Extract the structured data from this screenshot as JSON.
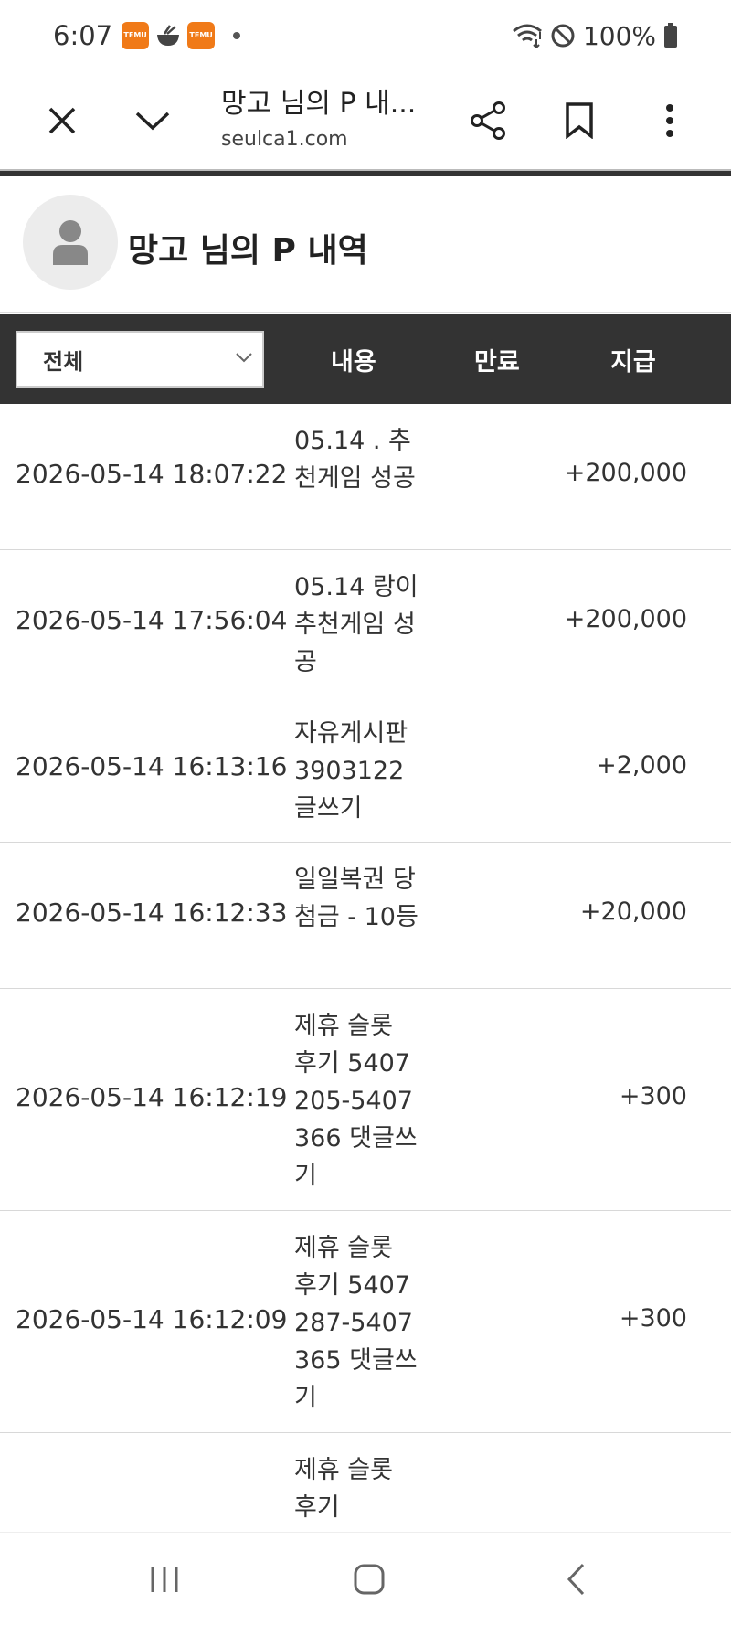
{
  "status_bar": {
    "time": "6:07",
    "notification_icons": [
      "temu-icon",
      "bowl-icon",
      "temu-icon"
    ],
    "temu_label": "TEMU",
    "battery": "100%"
  },
  "browser": {
    "title": "망고 님의 P 내...",
    "url": "seulca1.com"
  },
  "profile": {
    "title": "망고 님의 P 내역"
  },
  "table": {
    "filter_value": "전체",
    "headers": {
      "content": "내용",
      "expiry": "만료",
      "amount": "지급"
    },
    "rows": [
      {
        "date": "2026-05-14 18:07:22",
        "desc": "05.14 . 추천게임 성공",
        "expiry": "",
        "amount": "+200,000"
      },
      {
        "date": "2026-05-14 17:56:04",
        "desc": "05.14 랑이 추천게임 성공",
        "expiry": "",
        "amount": "+200,000"
      },
      {
        "date": "2026-05-14 16:13:16",
        "desc": "자유게시판 3903122 글쓰기",
        "expiry": "",
        "amount": "+2,000"
      },
      {
        "date": "2026-05-14 16:12:33",
        "desc": "일일복권 당첨금 - 10등",
        "expiry": "",
        "amount": "+20,000"
      },
      {
        "date": "2026-05-14 16:12:19",
        "desc": "제휴 슬롯 후기 5407205-5407366 댓글쓰기",
        "expiry": "",
        "amount": "+300"
      },
      {
        "date": "2026-05-14 16:12:09",
        "desc": "제휴 슬롯 후기 5407287-5407365 댓글쓰기",
        "expiry": "",
        "amount": "+300"
      },
      {
        "date": "",
        "desc": "제휴 슬롯 후기",
        "expiry": "",
        "amount": ""
      }
    ]
  },
  "colors": {
    "table_header_bg": "#333333",
    "temu_orange": "#f07a18"
  }
}
